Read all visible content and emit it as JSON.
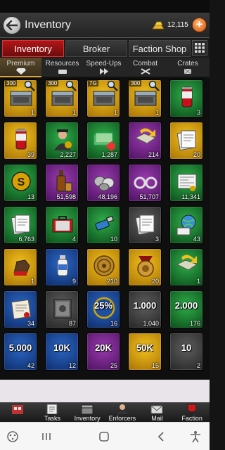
{
  "header": {
    "title": "Inventory",
    "gold_count": "12,115",
    "add_label": "+"
  },
  "main_tabs": [
    {
      "label": "Inventory",
      "active": true
    },
    {
      "label": "Broker",
      "active": false
    },
    {
      "label": "Faction Shop",
      "active": false
    }
  ],
  "sub_tabs": [
    {
      "label": "Premium",
      "active": true
    },
    {
      "label": "Resources",
      "active": false
    },
    {
      "label": "Speed-Ups",
      "active": false
    },
    {
      "label": "Combat",
      "active": false
    },
    {
      "label": "Crates",
      "active": false
    }
  ],
  "items": [
    {
      "bg": "gold",
      "art": "chest-icon",
      "count": "1",
      "tag": "300"
    },
    {
      "bg": "gold",
      "art": "chest-icon",
      "count": "1",
      "tag": "300"
    },
    {
      "bg": "gold",
      "art": "chest-icon",
      "count": "1",
      "tag": "7G"
    },
    {
      "bg": "gold",
      "art": "chest-icon",
      "count": "1",
      "tag": "300"
    },
    {
      "bg": "green",
      "art": "can-icon",
      "count": "3"
    },
    {
      "bg": "gold",
      "art": "can-icon",
      "count": "39"
    },
    {
      "bg": "green",
      "art": "gangster-icon",
      "count": "2,227"
    },
    {
      "bg": "green",
      "art": "cash-arrow-icon",
      "count": "1,287"
    },
    {
      "bg": "purple",
      "art": "map-arrow-icon",
      "count": "214"
    },
    {
      "bg": "gold",
      "art": "documents-icon",
      "count": "20"
    },
    {
      "bg": "green",
      "art": "s-badge-icon",
      "count": "13"
    },
    {
      "bg": "purple",
      "art": "whiskey-icon",
      "count": "51,598"
    },
    {
      "bg": "purple",
      "art": "cylinders-icon",
      "count": "48,196"
    },
    {
      "bg": "purple",
      "art": "handcuffs-icon",
      "count": "51,707"
    },
    {
      "bg": "green",
      "art": "newspaper-icon",
      "count": "11,341"
    },
    {
      "bg": "green",
      "art": "documents-icon",
      "count": "6,763"
    },
    {
      "bg": "green",
      "art": "briefcase-icon",
      "count": "4"
    },
    {
      "bg": "green",
      "art": "usb-icon",
      "count": "10"
    },
    {
      "bg": "gray",
      "art": "documents-icon",
      "count": "3"
    },
    {
      "bg": "green",
      "art": "globe-icon",
      "count": "43"
    },
    {
      "bg": "gold",
      "art": "glove-icon",
      "count": "1"
    },
    {
      "bg": "blue",
      "art": "bottle-icon",
      "count": "9"
    },
    {
      "bg": "gold",
      "art": "coin-icon",
      "count": "210"
    },
    {
      "bg": "gold",
      "art": "medal-icon",
      "count": "20"
    },
    {
      "bg": "green",
      "art": "map-arrow-icon",
      "count": "1"
    },
    {
      "bg": "blue",
      "art": "scroll-icon",
      "count": "34"
    },
    {
      "bg": "gray",
      "art": "safe-icon",
      "count": "87"
    },
    {
      "bg": "blue",
      "art": "percent-badge-icon",
      "count": "16",
      "label": "25%"
    },
    {
      "bg": "gray",
      "art": "blank",
      "count": "1,040",
      "label": "1.000"
    },
    {
      "bg": "green",
      "art": "blank",
      "count": "176",
      "label": "2.000"
    },
    {
      "bg": "blue",
      "art": "blank",
      "count": "42",
      "label": "5.000"
    },
    {
      "bg": "blue",
      "art": "blank",
      "count": "12",
      "label": "10K"
    },
    {
      "bg": "purple",
      "art": "blank",
      "count": "25",
      "label": "20K"
    },
    {
      "bg": "gold",
      "art": "blank",
      "count": "15",
      "label": "50K"
    },
    {
      "bg": "gray",
      "art": "blank",
      "count": "2",
      "label": "10"
    }
  ],
  "bottom_bar": [
    {
      "label": "",
      "icon": "building-icon"
    },
    {
      "label": "Tasks",
      "icon": "tasks-icon"
    },
    {
      "label": "Inventory",
      "icon": "inventory-icon"
    },
    {
      "label": "Enforcers",
      "icon": "enforcers-icon"
    },
    {
      "label": "Mail",
      "icon": "mail-icon"
    },
    {
      "label": "Faction",
      "icon": "faction-icon"
    }
  ],
  "colors": {
    "accent_red": "#b0171a",
    "gold": "#f2c21c",
    "green": "#2fae4a",
    "purple": "#9b3bb0",
    "blue": "#2c67c4"
  }
}
